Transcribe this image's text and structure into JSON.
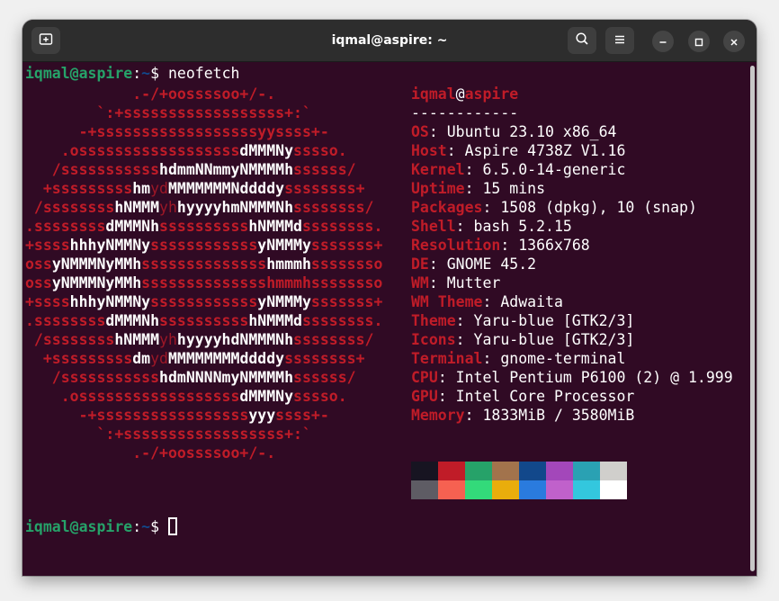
{
  "window": {
    "title": "iqmal@aspire: ~"
  },
  "titlebar": {
    "new_tab_icon": "new-tab-icon",
    "search_icon": "search-icon",
    "menu_icon": "hamburger-menu-icon",
    "minimize_icon": "minimize-icon",
    "maximize_icon": "maximize-icon",
    "close_icon": "close-icon"
  },
  "prompt": {
    "user_host": "iqmal@aspire",
    "colon": ":",
    "path": "~",
    "symbol": "$ ",
    "command": "neofetch"
  },
  "logo_lines": [
    [
      [
        "r",
        "            .-/+oossssoo+/-."
      ]
    ],
    [
      [
        "r",
        "        `:+ssssssssssssssssss+:`"
      ]
    ],
    [
      [
        "r",
        "      -+ssssssssssssssssssyyssss+-"
      ]
    ],
    [
      [
        "r",
        "    .ossssssssssssssssss"
      ],
      [
        "w",
        "dMMMNy"
      ],
      [
        "r",
        "sssso."
      ]
    ],
    [
      [
        "r",
        "   /sssssssssss"
      ],
      [
        "w",
        "hdmmNNmmyNMMMMh"
      ],
      [
        "r",
        "ssssss/"
      ]
    ],
    [
      [
        "r",
        "  +sssssssss"
      ],
      [
        "w",
        "hm"
      ],
      [
        "d",
        "yd"
      ],
      [
        "w",
        "MMMMMMMNddddy"
      ],
      [
        "r",
        "ssssssss+"
      ]
    ],
    [
      [
        "r",
        " /ssssssss"
      ],
      [
        "w",
        "hNMMM"
      ],
      [
        "d",
        "yh"
      ],
      [
        "w",
        "hyyyyhmNMMMNh"
      ],
      [
        "r",
        "ssssssss/"
      ]
    ],
    [
      [
        "r",
        ".ssssssss"
      ],
      [
        "w",
        "dMMMNh"
      ],
      [
        "r",
        "ssssssssss"
      ],
      [
        "w",
        "hNMMMd"
      ],
      [
        "r",
        "ssssssss."
      ]
    ],
    [
      [
        "r",
        "+ssss"
      ],
      [
        "w",
        "hhhyNMMNy"
      ],
      [
        "r",
        "ssssssssssss"
      ],
      [
        "w",
        "yNMMMy"
      ],
      [
        "r",
        "sssssss+"
      ]
    ],
    [
      [
        "r",
        "oss"
      ],
      [
        "w",
        "yNMMMNyMMh"
      ],
      [
        "r",
        "ssssssssssssss"
      ],
      [
        "w",
        "hmmmh"
      ],
      [
        "r",
        "ssssssso"
      ]
    ],
    [
      [
        "r",
        "oss"
      ],
      [
        "w",
        "yNMMMNyMMh"
      ],
      [
        "r",
        "sssssssssssssshmmmhssssssso"
      ]
    ],
    [
      [
        "r",
        "+ssss"
      ],
      [
        "w",
        "hhhyNMMNy"
      ],
      [
        "r",
        "ssssssssssss"
      ],
      [
        "w",
        "yNMMMy"
      ],
      [
        "r",
        "sssssss+"
      ]
    ],
    [
      [
        "r",
        ".ssssssss"
      ],
      [
        "w",
        "dMMMNh"
      ],
      [
        "r",
        "ssssssssss"
      ],
      [
        "w",
        "hNMMMd"
      ],
      [
        "r",
        "ssssssss."
      ]
    ],
    [
      [
        "r",
        " /ssssssss"
      ],
      [
        "w",
        "hNMMM"
      ],
      [
        "d",
        "yh"
      ],
      [
        "w",
        "hyyyyhdNMMMNh"
      ],
      [
        "r",
        "ssssssss/"
      ]
    ],
    [
      [
        "r",
        "  +sssssssss"
      ],
      [
        "w",
        "dm"
      ],
      [
        "d",
        "yd"
      ],
      [
        "w",
        "MMMMMMMMddddy"
      ],
      [
        "r",
        "ssssssss+"
      ]
    ],
    [
      [
        "r",
        "   /sssssssssss"
      ],
      [
        "w",
        "hdmNNNNmyNMMMMh"
      ],
      [
        "r",
        "ssssss/"
      ]
    ],
    [
      [
        "r",
        "    .ossssssssssssssssss"
      ],
      [
        "w",
        "dMMMNy"
      ],
      [
        "r",
        "sssso."
      ]
    ],
    [
      [
        "r",
        "      -+sssssssssssssssss"
      ],
      [
        "w",
        "yyy"
      ],
      [
        "r",
        "ssss+-"
      ]
    ],
    [
      [
        "r",
        "        `:+ssssssssssssssssss+:`"
      ]
    ],
    [
      [
        "r",
        "            .-/+oossssoo+/-."
      ]
    ]
  ],
  "info": {
    "user": "iqmal",
    "at": "@",
    "host": "aspire",
    "separator": "------------",
    "fields": [
      {
        "key": "OS",
        "value": ": Ubuntu 23.10 x86_64"
      },
      {
        "key": "Host",
        "value": ": Aspire 4738Z V1.16"
      },
      {
        "key": "Kernel",
        "value": ": 6.5.0-14-generic"
      },
      {
        "key": "Uptime",
        "value": ": 15 mins"
      },
      {
        "key": "Packages",
        "value": ": 1508 (dpkg), 10 (snap)"
      },
      {
        "key": "Shell",
        "value": ": bash 5.2.15"
      },
      {
        "key": "Resolution",
        "value": ": 1366x768"
      },
      {
        "key": "DE",
        "value": ": GNOME 45.2"
      },
      {
        "key": "WM",
        "value": ": Mutter"
      },
      {
        "key": "WM Theme",
        "value": ": Adwaita"
      },
      {
        "key": "Theme",
        "value": ": Yaru-blue [GTK2/3]"
      },
      {
        "key": "Icons",
        "value": ": Yaru-blue [GTK2/3]"
      },
      {
        "key": "Terminal",
        "value": ": gnome-terminal"
      },
      {
        "key": "CPU",
        "value": ": Intel Pentium P6100 (2) @ 1.999"
      },
      {
        "key": "GPU",
        "value": ": Intel Core Processor"
      },
      {
        "key": "Memory",
        "value": ": 1833MiB / 3580MiB"
      }
    ]
  },
  "palette": {
    "normal": [
      "#171421",
      "#c01c28",
      "#26a269",
      "#a2734c",
      "#12488b",
      "#a347ba",
      "#2aa1b3",
      "#d0cfcc"
    ],
    "bright": [
      "#5e5c64",
      "#f66151",
      "#33da7a",
      "#e9ad0c",
      "#2a7bde",
      "#c061cb",
      "#33c7de",
      "#ffffff"
    ]
  },
  "colors": {
    "terminal_bg": "#300a24",
    "titlebar_bg": "#2d2d2d",
    "prompt_user": "#26a269",
    "prompt_path": "#12488b",
    "accent_red": "#c01c28"
  }
}
